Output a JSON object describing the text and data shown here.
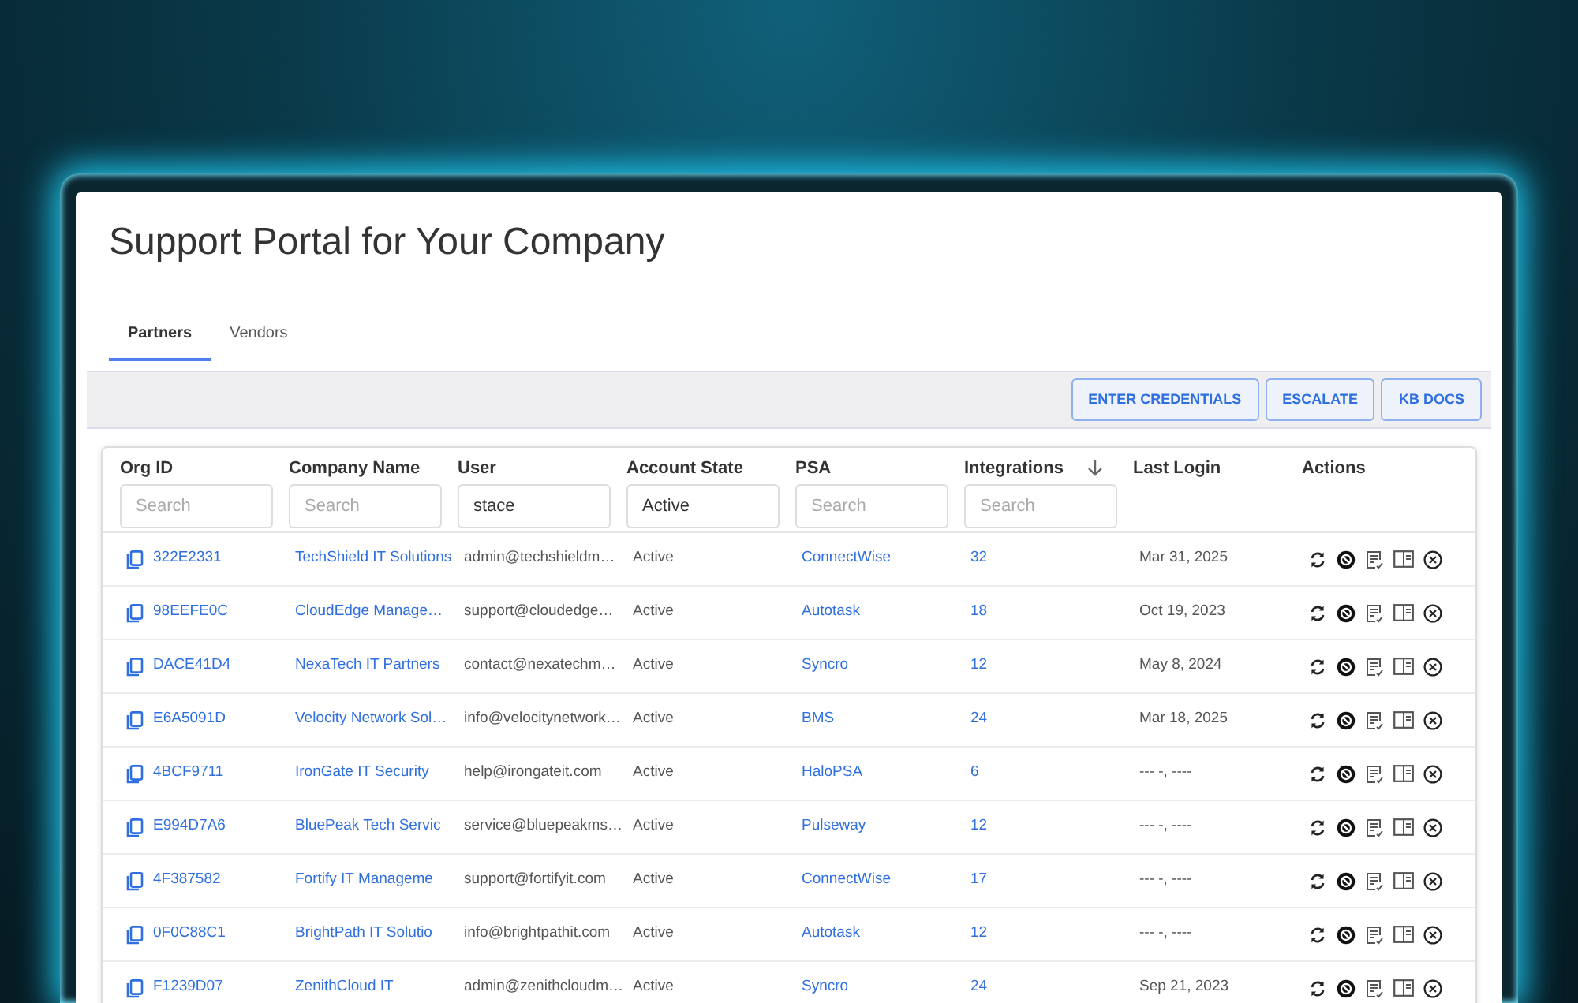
{
  "title": "Support Portal for Your Company",
  "tabs": [
    {
      "label": "Partners",
      "selected": true
    },
    {
      "label": "Vendors",
      "selected": false
    }
  ],
  "toolbar_buttons": [
    "ENTER CREDENTIALS",
    "ESCALATE",
    "KB DOCS"
  ],
  "table": {
    "columns": [
      {
        "label": "Org ID",
        "filter": {
          "placeholder": "Search"
        }
      },
      {
        "label": "Company Name",
        "filter": {
          "placeholder": "Search"
        }
      },
      {
        "label": "User",
        "filter": {
          "value": "stace"
        }
      },
      {
        "label": "Account State",
        "filter": {
          "value": "Active"
        }
      },
      {
        "label": "PSA",
        "filter": {
          "placeholder": "Search"
        }
      },
      {
        "label": "Integrations",
        "sorted": true,
        "filter": {
          "placeholder": "Search"
        }
      },
      {
        "label": "Last Login"
      },
      {
        "label": "Actions"
      }
    ],
    "rows": [
      {
        "org_id": "322E2331",
        "company": "TechShield IT Solutions",
        "user": "admin@techshieldm…",
        "account_state": "Active",
        "psa": "ConnectWise",
        "integrations": "32",
        "last_login": "Mar 31, 2025"
      },
      {
        "org_id": "98EEFE0C",
        "company": "CloudEdge Manage…",
        "user": "support@cloudedge…",
        "account_state": "Active",
        "psa": "Autotask",
        "integrations": "18",
        "last_login": "Oct 19, 2023"
      },
      {
        "org_id": "DACE41D4",
        "company": "NexaTech IT Partners",
        "user": "contact@nexatechm…",
        "account_state": "Active",
        "psa": "Syncro",
        "integrations": "12",
        "last_login": "May 8, 2024"
      },
      {
        "org_id": "E6A5091D",
        "company": "Velocity Network Sol…",
        "user": "info@velocitynetwork…",
        "account_state": "Active",
        "psa": "BMS",
        "integrations": "24",
        "last_login": "Mar 18, 2025"
      },
      {
        "org_id": "4BCF9711",
        "company": "IronGate IT Security",
        "user": "help@irongateit.com",
        "account_state": "Active",
        "psa": "HaloPSA",
        "integrations": "6",
        "last_login": "--- -, ----"
      },
      {
        "org_id": "E994D7A6",
        "company": "BluePeak Tech Servic",
        "user": "service@bluepeakms…",
        "account_state": "Active",
        "psa": "Pulseway",
        "integrations": "12",
        "last_login": "--- -, ----"
      },
      {
        "org_id": "4F387582",
        "company": "Fortify IT Manageme",
        "user": "support@fortifyit.com",
        "account_state": "Active",
        "psa": "ConnectWise",
        "integrations": "17",
        "last_login": "--- -, ----"
      },
      {
        "org_id": "0F0C88C1",
        "company": "BrightPath IT Solutio",
        "user": "info@brightpathit.com",
        "account_state": "Active",
        "psa": "Autotask",
        "integrations": "12",
        "last_login": "--- -, ----"
      },
      {
        "org_id": "F1239D07",
        "company": "ZenithCloud IT",
        "user": "admin@zenithcloudm…",
        "account_state": "Active",
        "psa": "Syncro",
        "integrations": "24",
        "last_login": "Sep 21, 2023"
      }
    ]
  }
}
